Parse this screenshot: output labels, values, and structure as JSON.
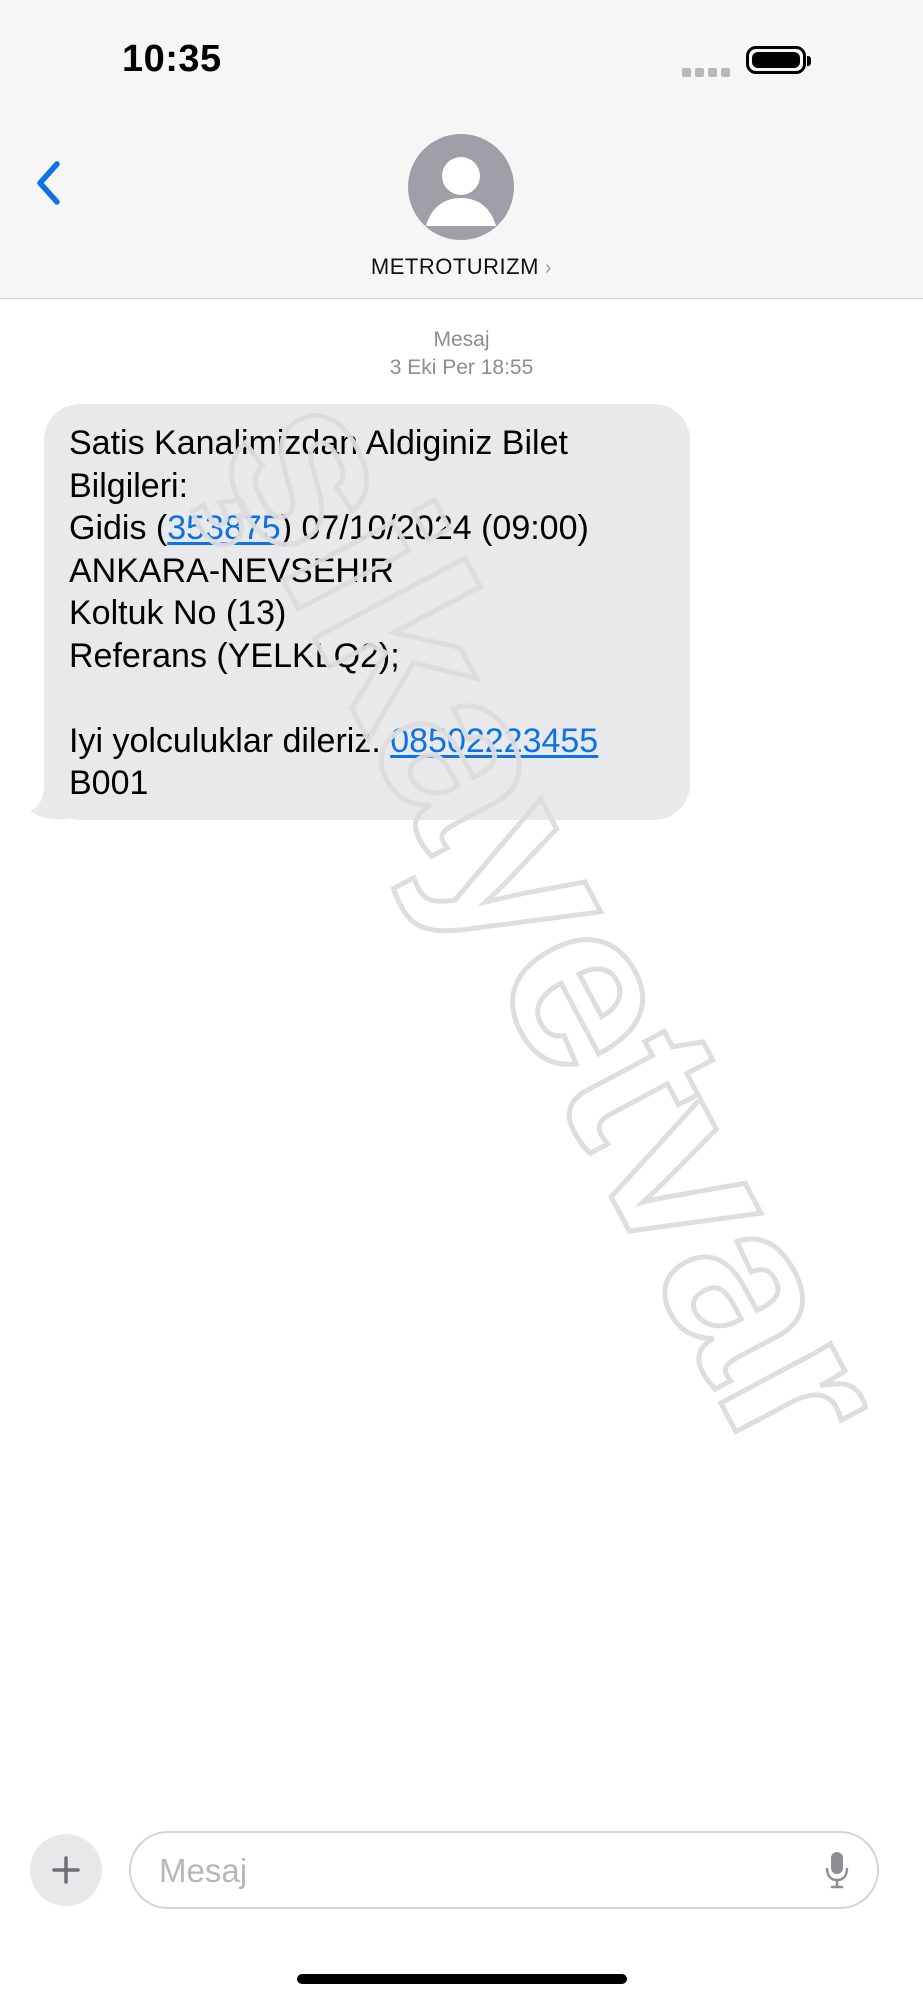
{
  "status_bar": {
    "time": "10:35"
  },
  "header": {
    "contact_name": "METROTURIZM"
  },
  "conversation": {
    "service_label": "Mesaj",
    "timestamp": "3 Eki Per 18:55",
    "message": {
      "line1": "Satis Kanalimizdan Aldiginiz Bilet",
      "line2": "Bilgileri:",
      "line3_prefix": "Gidis (",
      "line3_link": "353875",
      "line3_suffix": ") 07/10/2024 (09:00)",
      "line4": "ANKARA-NEVSEHIR",
      "line5": "Koltuk No (13)",
      "line6": "Referans (YELKLQ2);",
      "line8_prefix": "Iyi yolculuklar dileriz. ",
      "line8_link": "08502223455",
      "line9": "B001"
    }
  },
  "composer": {
    "placeholder": "Mesaj"
  },
  "watermark_text": "şikayetvar",
  "colors": {
    "accent": "#0b72e8",
    "bubble": "#e9e9eb",
    "header_bg": "#f6f6f6"
  },
  "icons": {
    "back": "chevron-left-icon",
    "avatar": "person-icon",
    "add": "plus-icon",
    "mic": "microphone-icon"
  }
}
